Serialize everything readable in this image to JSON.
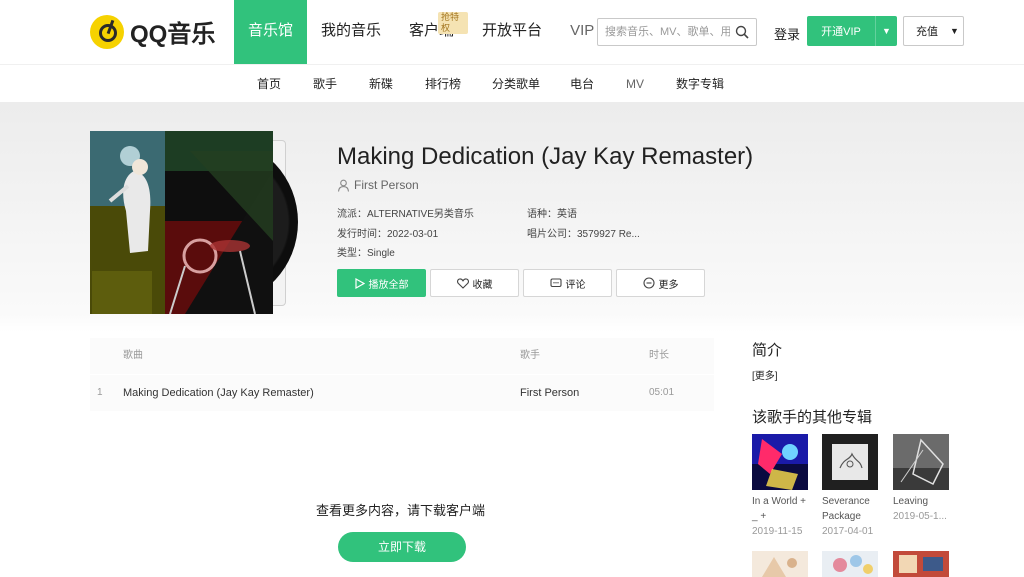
{
  "header": {
    "logo_text": "QQ音乐",
    "nav": [
      {
        "label": "音乐馆"
      },
      {
        "label": "我的音乐"
      },
      {
        "label": "客户端",
        "tag": "抢特权"
      },
      {
        "label": "开放平台"
      },
      {
        "label": "VIP"
      }
    ],
    "search_placeholder": "搜索音乐、MV、歌单、用户",
    "login_label": "登录",
    "vip_button_label": "开通VIP",
    "charge_button_label": "充值"
  },
  "subnav": [
    "首页",
    "歌手",
    "新碟",
    "排行榜",
    "分类歌单",
    "电台",
    "MV",
    "数字专辑"
  ],
  "album": {
    "title": "Making Dedication (Jay Kay Remaster)",
    "singer": "First Person",
    "genre_label": "流派：",
    "genre": "ALTERNATIVE另类音乐",
    "language_label": "语种：",
    "language": "英语",
    "release_label": "发行时间：",
    "release_date": "2022-03-01",
    "company_label": "唱片公司：",
    "company": "3579927 Re...",
    "type_label": "类型：",
    "type": "Single"
  },
  "actions": {
    "play_all": "播放全部",
    "collect": "收藏",
    "comment": "评论",
    "more": "更多"
  },
  "songlist": {
    "headers": {
      "song": "歌曲",
      "singer": "歌手",
      "duration": "时长"
    },
    "rows": [
      {
        "index": "1",
        "title": "Making Dedication (Jay Kay Remaster)",
        "singer": "First Person",
        "duration": "05:01"
      }
    ]
  },
  "prompt": {
    "text": "查看更多内容，请下载客户端",
    "download_label": "立即下载"
  },
  "sidebar": {
    "intro_title": "简介",
    "intro_more": "[更多]",
    "other_albums_title": "该歌手的其他专辑",
    "other_albums": [
      {
        "name": "In a World + _ +",
        "date": "2019-11-15"
      },
      {
        "name": "Severance Package",
        "date": "2017-04-01"
      },
      {
        "name": "Leaving",
        "date": "2019-05-1..."
      }
    ]
  },
  "colors": {
    "accent": "#31c27c",
    "logo_yellow": "#f6d200"
  }
}
